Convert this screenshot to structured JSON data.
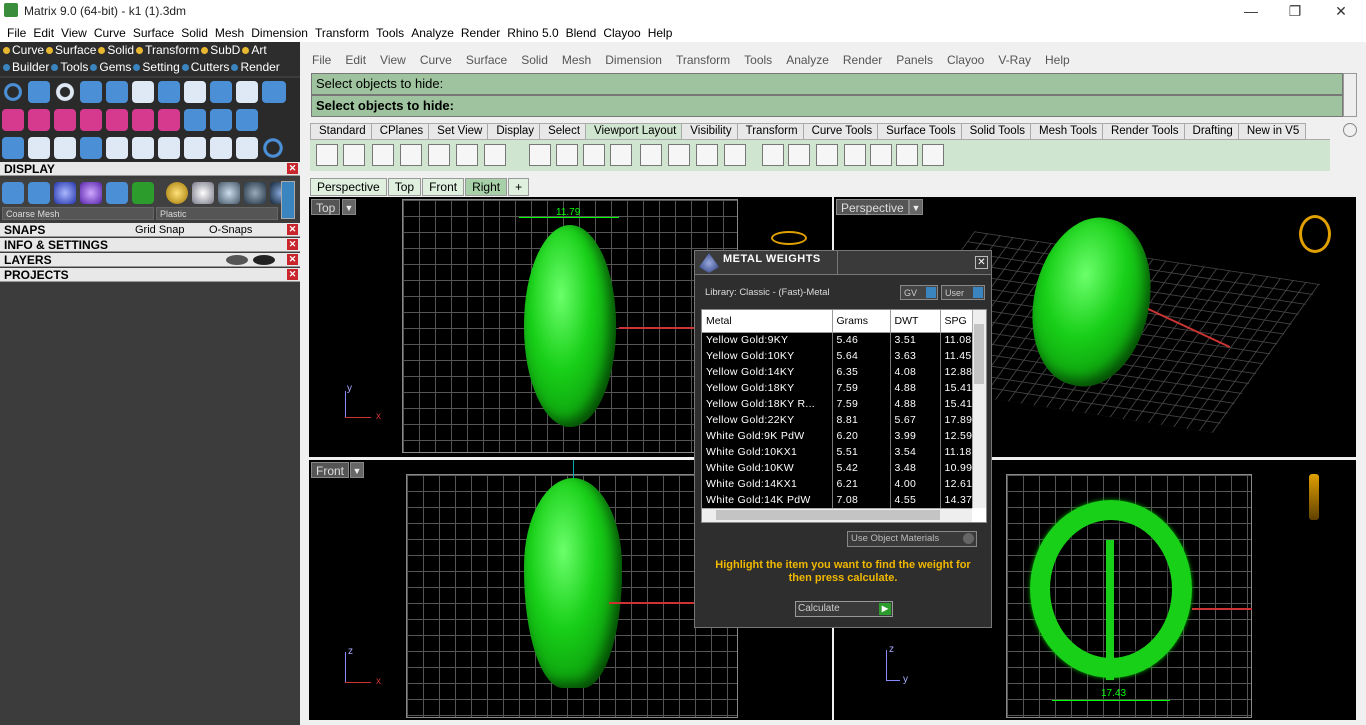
{
  "window": {
    "title": "Matrix 9.0 (64-bit) - k1 (1).3dm",
    "minimize": "—",
    "restore": "❐",
    "close": "✕"
  },
  "menubar": [
    "File",
    "Edit",
    "View",
    "Curve",
    "Surface",
    "Solid",
    "Mesh",
    "Dimension",
    "Transform",
    "Tools",
    "Analyze",
    "Render",
    "Rhino 5.0",
    "Blend",
    "Clayoo",
    "Help"
  ],
  "left_tabs_row1": [
    "Curve",
    "Surface",
    "Solid",
    "Transform",
    "SubD",
    "Art"
  ],
  "left_tabs_row2": [
    "Builder",
    "Tools",
    "Gems",
    "Setting",
    "Cutters",
    "Render"
  ],
  "display": {
    "title": "DISPLAY",
    "mesh_select": "Coarse Mesh",
    "material_select": "Plastic"
  },
  "snaps": {
    "title": "SNAPS",
    "grid_snap": "Grid Snap",
    "osnaps": "O-Snaps"
  },
  "info": {
    "title": "INFO & SETTINGS"
  },
  "layers": {
    "title": "LAYERS"
  },
  "projects": {
    "title": "PROJECTS"
  },
  "rhino_menu": [
    "File",
    "Edit",
    "View",
    "Curve",
    "Surface",
    "Solid",
    "Mesh",
    "Dimension",
    "Transform",
    "Tools",
    "Analyze",
    "Render",
    "Panels",
    "Clayoo",
    "V-Ray",
    "Help"
  ],
  "command": {
    "history": "Select objects to hide:",
    "prompt": "Select objects to hide:"
  },
  "toolbar_tabs": [
    "Standard",
    "CPlanes",
    "Set View",
    "Display",
    "Select",
    "Viewport Layout",
    "Visibility",
    "Transform",
    "Curve Tools",
    "Surface Tools",
    "Solid Tools",
    "Mesh Tools",
    "Render Tools",
    "Drafting",
    "New in V5"
  ],
  "viewport_tabs": [
    "Perspective",
    "Top",
    "Front",
    "Right",
    "+"
  ],
  "viewports": {
    "top": {
      "label": "Top",
      "dim": "11.79"
    },
    "perspective": {
      "label": "Perspective"
    },
    "front": {
      "label": "Front"
    },
    "right": {
      "label": "Right",
      "dim": "17.43"
    }
  },
  "dialog": {
    "title": "METAL WEIGHTS",
    "library": "Library: Classic - (Fast)-Metal",
    "gv": "GV",
    "user": "User",
    "columns": [
      "Metal",
      "Grams",
      "DWT",
      "SPG"
    ],
    "rows": [
      [
        "Yellow Gold:9KY",
        "5.46",
        "3.51",
        "11.08"
      ],
      [
        "Yellow Gold:10KY",
        "5.64",
        "3.63",
        "11.45"
      ],
      [
        "Yellow Gold:14KY",
        "6.35",
        "4.08",
        "12.88"
      ],
      [
        "Yellow Gold:18KY",
        "7.59",
        "4.88",
        "15.41"
      ],
      [
        "Yellow Gold:18KY R...",
        "7.59",
        "4.88",
        "15.41"
      ],
      [
        "Yellow Gold:22KY",
        "8.81",
        "5.67",
        "17.89"
      ],
      [
        "White Gold:9K PdW",
        "6.20",
        "3.99",
        "12.59"
      ],
      [
        "White Gold:10KX1",
        "5.51",
        "3.54",
        "11.18"
      ],
      [
        "White Gold:10KW",
        "5.42",
        "3.48",
        "10.99"
      ],
      [
        "White Gold:14KX1",
        "6.21",
        "4.00",
        "12.61"
      ],
      [
        "White Gold:14K PdW",
        "7.08",
        "4.55",
        "14.37"
      ]
    ],
    "use_object_materials": "Use Object Materials",
    "highlight_text": "Highlight the item you want to find the weight for then press calculate.",
    "calculate": "Calculate"
  },
  "axes": {
    "x": "x",
    "y": "y",
    "z": "z"
  }
}
